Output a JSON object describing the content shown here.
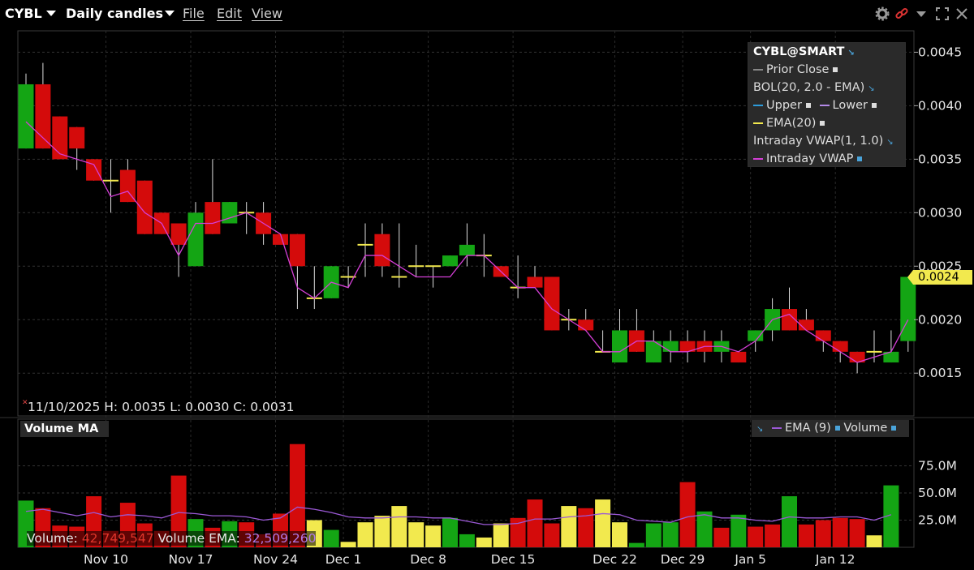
{
  "toolbar": {
    "symbol": "CYBL",
    "interval": "Daily candles",
    "menu_file": "File",
    "menu_edit": "Edit",
    "menu_view": "View",
    "icons": [
      "gear-icon",
      "link-icon",
      "chevron-down-icon",
      "expand-icon",
      "close-icon"
    ]
  },
  "legend": {
    "title": "CYBL@SMART",
    "prior_close": "Prior Close",
    "bol": "BOL(20, 2.0 - EMA)",
    "upper": "Upper",
    "lower": "Lower",
    "ema": "EMA(20)",
    "vwap_group": "Intraday VWAP(1, 1.0)",
    "vwap": "Intraday VWAP"
  },
  "readout": {
    "date": "11/10/2025",
    "h_label": "H:",
    "h": "0.0035",
    "l_label": "L:",
    "l": "0.0030",
    "c_label": "C:",
    "c": "0.0031"
  },
  "last_price_tag": "0.0024",
  "volume_panel": {
    "title": "Volume MA",
    "legend_ema": "EMA (9)",
    "legend_volume": "Volume",
    "volume_label": "Volume:",
    "volume_value": "42,749,547",
    "ema_label": "Volume EMA:",
    "ema_value": "32,509,260"
  },
  "colors": {
    "up": "#14a514",
    "down": "#d40b0b",
    "doji": "#f2e94e",
    "vwap": "#d43fd6",
    "vol_ema": "#9b59d6",
    "price_tag": "#f2e94e"
  },
  "chart_data": {
    "type": "candlestick",
    "price_axis": {
      "min": 0.0011,
      "max": 0.0047,
      "ticks": [
        "0.0045",
        "0.0040",
        "0.0035",
        "0.0030",
        "0.0025",
        "0.0020",
        "0.0015"
      ]
    },
    "volume_axis": {
      "min": 0,
      "max": 100000000,
      "ticks": [
        "75.0M",
        "50.0M",
        "25.0M"
      ]
    },
    "x_labels": [
      "Nov 10",
      "Nov 17",
      "Nov 24",
      "Dec 1",
      "Dec 8",
      "Dec 15",
      "Dec 22",
      "Dec 29",
      "Jan 5",
      "Jan 12"
    ],
    "x_label_index": [
      5,
      10,
      15,
      19,
      24,
      29,
      35,
      39,
      43,
      48
    ],
    "candles": [
      {
        "o": 0.0036,
        "h": 0.0043,
        "l": 0.0036,
        "c": 0.0042
      },
      {
        "o": 0.0042,
        "h": 0.0044,
        "l": 0.0036,
        "c": 0.0036
      },
      {
        "o": 0.0039,
        "h": 0.0039,
        "l": 0.0035,
        "c": 0.0035
      },
      {
        "o": 0.0038,
        "h": 0.0038,
        "l": 0.0034,
        "c": 0.0036
      },
      {
        "o": 0.0035,
        "h": 0.0035,
        "l": 0.0033,
        "c": 0.0033
      },
      {
        "o": 0.0033,
        "h": 0.0035,
        "l": 0.003,
        "c": 0.0033
      },
      {
        "o": 0.0034,
        "h": 0.0035,
        "l": 0.0031,
        "c": 0.0031
      },
      {
        "o": 0.0033,
        "h": 0.0033,
        "l": 0.0028,
        "c": 0.0028
      },
      {
        "o": 0.003,
        "h": 0.003,
        "l": 0.0028,
        "c": 0.0028
      },
      {
        "o": 0.0029,
        "h": 0.0029,
        "l": 0.0024,
        "c": 0.0027
      },
      {
        "o": 0.0025,
        "h": 0.0031,
        "l": 0.0025,
        "c": 0.003
      },
      {
        "o": 0.0031,
        "h": 0.0035,
        "l": 0.0028,
        "c": 0.0028
      },
      {
        "o": 0.0029,
        "h": 0.0031,
        "l": 0.0029,
        "c": 0.0031
      },
      {
        "o": 0.003,
        "h": 0.0031,
        "l": 0.0028,
        "c": 0.003
      },
      {
        "o": 0.003,
        "h": 0.0031,
        "l": 0.0027,
        "c": 0.0028
      },
      {
        "o": 0.0028,
        "h": 0.0028,
        "l": 0.0028,
        "c": 0.0027
      },
      {
        "o": 0.0028,
        "h": 0.0028,
        "l": 0.0021,
        "c": 0.0025
      },
      {
        "o": 0.0022,
        "h": 0.0025,
        "l": 0.0021,
        "c": 0.0022
      },
      {
        "o": 0.0022,
        "h": 0.0025,
        "l": 0.0022,
        "c": 0.0025
      },
      {
        "o": 0.0024,
        "h": 0.0025,
        "l": 0.0023,
        "c": 0.0024
      },
      {
        "o": 0.0027,
        "h": 0.0029,
        "l": 0.0024,
        "c": 0.0027
      },
      {
        "o": 0.0028,
        "h": 0.0029,
        "l": 0.0024,
        "c": 0.0025
      },
      {
        "o": 0.0024,
        "h": 0.0029,
        "l": 0.0023,
        "c": 0.0024
      },
      {
        "o": 0.0025,
        "h": 0.0027,
        "l": 0.0024,
        "c": 0.0025
      },
      {
        "o": 0.0025,
        "h": 0.0025,
        "l": 0.0023,
        "c": 0.0025
      },
      {
        "o": 0.0025,
        "h": 0.0026,
        "l": 0.0025,
        "c": 0.0026
      },
      {
        "o": 0.0026,
        "h": 0.0029,
        "l": 0.0025,
        "c": 0.0027
      },
      {
        "o": 0.0026,
        "h": 0.0028,
        "l": 0.0024,
        "c": 0.0026
      },
      {
        "o": 0.0025,
        "h": 0.0025,
        "l": 0.0024,
        "c": 0.0024
      },
      {
        "o": 0.0023,
        "h": 0.0026,
        "l": 0.0022,
        "c": 0.0023
      },
      {
        "o": 0.0024,
        "h": 0.0025,
        "l": 0.0023,
        "c": 0.0023
      },
      {
        "o": 0.0024,
        "h": 0.0024,
        "l": 0.0019,
        "c": 0.0019
      },
      {
        "o": 0.002,
        "h": 0.0021,
        "l": 0.0019,
        "c": 0.002
      },
      {
        "o": 0.002,
        "h": 0.0021,
        "l": 0.0019,
        "c": 0.0019
      },
      {
        "o": 0.0017,
        "h": 0.0019,
        "l": 0.0017,
        "c": 0.0017
      },
      {
        "o": 0.0016,
        "h": 0.0021,
        "l": 0.0016,
        "c": 0.0019
      },
      {
        "o": 0.0019,
        "h": 0.0021,
        "l": 0.0017,
        "c": 0.0017
      },
      {
        "o": 0.0016,
        "h": 0.0019,
        "l": 0.0016,
        "c": 0.0018
      },
      {
        "o": 0.0017,
        "h": 0.0019,
        "l": 0.0016,
        "c": 0.0018
      },
      {
        "o": 0.0018,
        "h": 0.0019,
        "l": 0.0016,
        "c": 0.0017
      },
      {
        "o": 0.0018,
        "h": 0.0019,
        "l": 0.0016,
        "c": 0.0017
      },
      {
        "o": 0.0017,
        "h": 0.0019,
        "l": 0.0016,
        "c": 0.0018
      },
      {
        "o": 0.0017,
        "h": 0.0017,
        "l": 0.0016,
        "c": 0.0016
      },
      {
        "o": 0.0018,
        "h": 0.0019,
        "l": 0.0017,
        "c": 0.0019
      },
      {
        "o": 0.0019,
        "h": 0.0022,
        "l": 0.0018,
        "c": 0.0021
      },
      {
        "o": 0.0021,
        "h": 0.0023,
        "l": 0.0019,
        "c": 0.0019
      },
      {
        "o": 0.002,
        "h": 0.0021,
        "l": 0.0019,
        "c": 0.0019
      },
      {
        "o": 0.0019,
        "h": 0.0019,
        "l": 0.0017,
        "c": 0.0018
      },
      {
        "o": 0.0018,
        "h": 0.0018,
        "l": 0.0016,
        "c": 0.0017
      },
      {
        "o": 0.0017,
        "h": 0.0017,
        "l": 0.0015,
        "c": 0.0016
      },
      {
        "o": 0.0017,
        "h": 0.0019,
        "l": 0.0016,
        "c": 0.0017
      },
      {
        "o": 0.0016,
        "h": 0.0019,
        "l": 0.0016,
        "c": 0.0017
      },
      {
        "o": 0.0018,
        "h": 0.0024,
        "l": 0.0017,
        "c": 0.0024
      }
    ],
    "vwap": [
      0.00385,
      0.0037,
      0.00355,
      0.0035,
      0.00345,
      0.00315,
      0.0032,
      0.003,
      0.0029,
      0.0026,
      0.0029,
      0.0029,
      0.00295,
      0.003,
      0.0029,
      0.0028,
      0.0023,
      0.0022,
      0.00235,
      0.0023,
      0.0026,
      0.0026,
      0.0025,
      0.0024,
      0.0024,
      0.0024,
      0.0026,
      0.0026,
      0.00245,
      0.0023,
      0.0023,
      0.0021,
      0.002,
      0.0019,
      0.0017,
      0.0017,
      0.0018,
      0.0018,
      0.0017,
      0.0017,
      0.00175,
      0.00175,
      0.0017,
      0.0018,
      0.002,
      0.00205,
      0.0019,
      0.0018,
      0.0017,
      0.0016,
      0.00165,
      0.0017,
      0.002
    ],
    "volume": [
      43,
      36,
      20,
      19,
      47,
      15,
      41,
      22,
      15,
      66,
      26,
      18,
      24,
      23,
      12,
      31,
      95,
      25,
      16,
      5,
      23,
      29,
      38,
      23,
      20,
      27,
      12,
      9,
      22,
      27,
      44,
      22,
      38,
      36,
      44,
      23,
      4,
      22,
      23,
      60,
      33,
      18,
      30,
      19,
      21,
      47,
      21,
      25,
      27,
      26,
      11,
      57
    ],
    "volume_color": [
      "up",
      "down",
      "down",
      "down",
      "down",
      "down",
      "down",
      "down",
      "down",
      "down",
      "up",
      "down",
      "up",
      "down",
      "down",
      "down",
      "down",
      "doji",
      "up",
      "doji",
      "doji",
      "doji",
      "doji",
      "doji",
      "doji",
      "up",
      "up",
      "doji",
      "doji",
      "down",
      "down",
      "down",
      "doji",
      "down",
      "doji",
      "doji",
      "up",
      "up",
      "up",
      "down",
      "up",
      "down",
      "up",
      "down",
      "down",
      "up",
      "down",
      "down",
      "down",
      "down",
      "doji",
      "up"
    ],
    "volume_ema": [
      33,
      35,
      32,
      29,
      32,
      28,
      30,
      29,
      27,
      32,
      31,
      29,
      29,
      28,
      25,
      27,
      37,
      35,
      32,
      28,
      27,
      27,
      28,
      28,
      27,
      27,
      24,
      21,
      21,
      22,
      26,
      26,
      28,
      29,
      31,
      30,
      25,
      24,
      23,
      28,
      30,
      27,
      27,
      25,
      24,
      28,
      27,
      27,
      28,
      28,
      25,
      30
    ]
  }
}
